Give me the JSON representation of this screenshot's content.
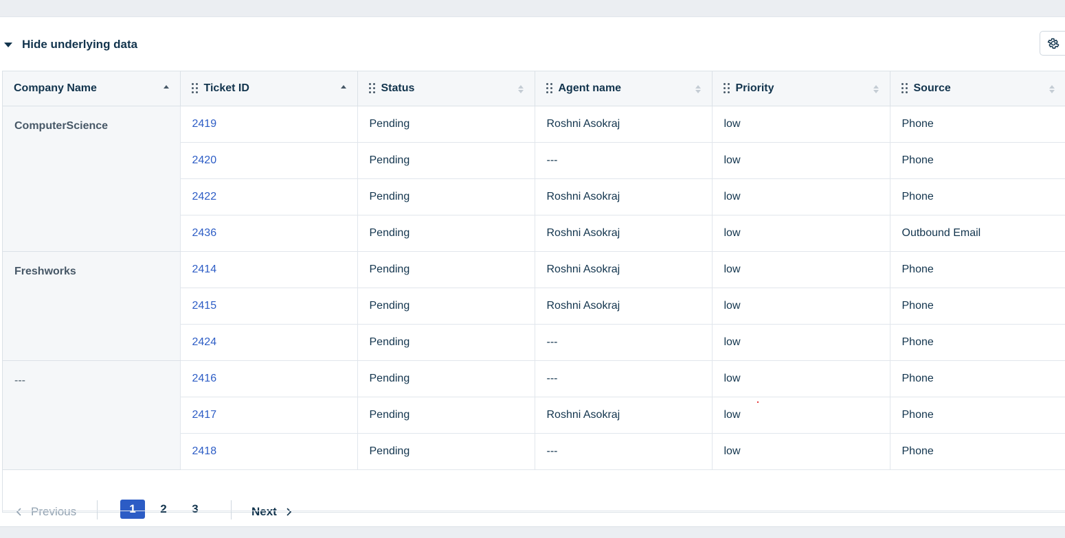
{
  "toggle": {
    "label": "Hide underlying data"
  },
  "columns": [
    "Company Name",
    "Ticket ID",
    "Status",
    "Agent name",
    "Priority",
    "Source"
  ],
  "groups": [
    {
      "company": "ComputerScience",
      "rows": [
        {
          "id": "2419",
          "status": "Pending",
          "agent": "Roshni Asokraj",
          "priority": "low",
          "source": "Phone"
        },
        {
          "id": "2420",
          "status": "Pending",
          "agent": "---",
          "priority": "low",
          "source": "Phone"
        },
        {
          "id": "2422",
          "status": "Pending",
          "agent": "Roshni Asokraj",
          "priority": "low",
          "source": "Phone"
        },
        {
          "id": "2436",
          "status": "Pending",
          "agent": "Roshni Asokraj",
          "priority": "low",
          "source": "Outbound Email"
        }
      ]
    },
    {
      "company": "Freshworks",
      "rows": [
        {
          "id": "2414",
          "status": "Pending",
          "agent": "Roshni Asokraj",
          "priority": "low",
          "source": "Phone"
        },
        {
          "id": "2415",
          "status": "Pending",
          "agent": "Roshni Asokraj",
          "priority": "low",
          "source": "Phone"
        },
        {
          "id": "2424",
          "status": "Pending",
          "agent": "---",
          "priority": "low",
          "source": "Phone"
        }
      ]
    },
    {
      "company": "---",
      "rows": [
        {
          "id": "2416",
          "status": "Pending",
          "agent": "---",
          "priority": "low",
          "source": "Phone"
        },
        {
          "id": "2417",
          "status": "Pending",
          "agent": "Roshni Asokraj",
          "priority": "low",
          "source": "Phone"
        },
        {
          "id": "2418",
          "status": "Pending",
          "agent": "---",
          "priority": "low",
          "source": "Phone"
        }
      ]
    }
  ],
  "pagination": {
    "previous_label": "Previous",
    "next_label": "Next",
    "pages": [
      "1",
      "2",
      "3"
    ],
    "current": "1"
  },
  "colors": {
    "accent": "#2c5cc5",
    "text": "#12344d",
    "header_bg": "#f5f7f9"
  },
  "icons": {
    "settings": "gear-icon",
    "toggle": "caret-down-icon",
    "drag": "drag-handle-icon",
    "sort": "sort-icon"
  }
}
